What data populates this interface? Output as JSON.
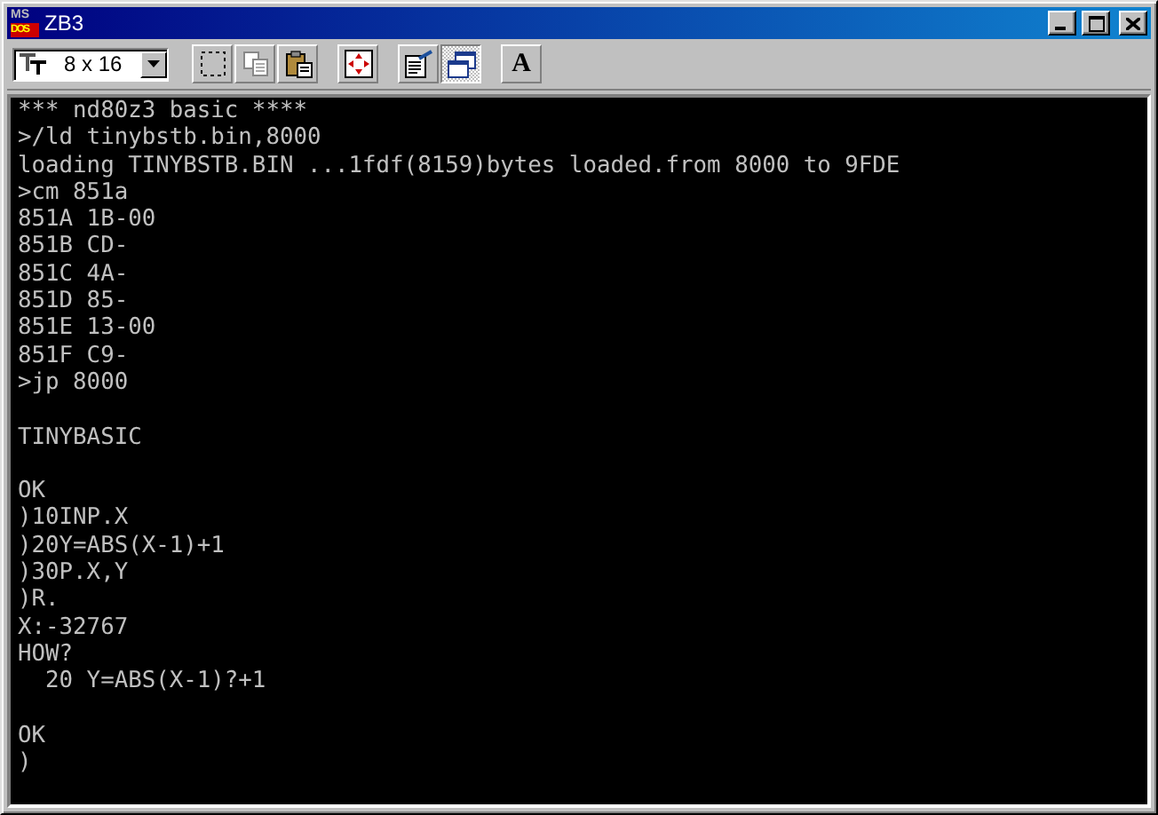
{
  "window": {
    "title": "ZB3",
    "app_icon_text": [
      "MS",
      "DOS"
    ]
  },
  "toolbar": {
    "font_size": "8 x 16",
    "buttons": [
      {
        "kind": "mark",
        "pressed": false
      },
      {
        "kind": "copy",
        "pressed": false
      },
      {
        "kind": "paste",
        "pressed": false
      },
      {
        "kind": "fullscreen",
        "pressed": false
      },
      {
        "kind": "properties",
        "pressed": false
      },
      {
        "kind": "background",
        "pressed": true
      },
      {
        "kind": "font",
        "pressed": false,
        "label": "A"
      }
    ]
  },
  "console": {
    "blocks": [
      [
        "*** nd80z3 basic ****",
        ">/ld tinybstb.bin,8000",
        "loading TINYBSTB.BIN ...1fdf(8159)bytes loaded.from 8000 to 9FDE",
        ">cm 851a",
        "851A 1B-00",
        "851B CD-",
        "851C 4A-",
        "851D 85-",
        "851E 13-00",
        "851F C9-",
        ">jp 8000"
      ],
      [
        "TINYBASIC"
      ],
      [
        "OK",
        ")10INP.X",
        ")20Y=ABS(X-1)+1",
        ")30P.X,Y",
        ")R.",
        "X:-32767",
        "HOW?",
        "  20 Y=ABS(X-1)?+1"
      ],
      [
        "OK",
        ")"
      ]
    ]
  }
}
